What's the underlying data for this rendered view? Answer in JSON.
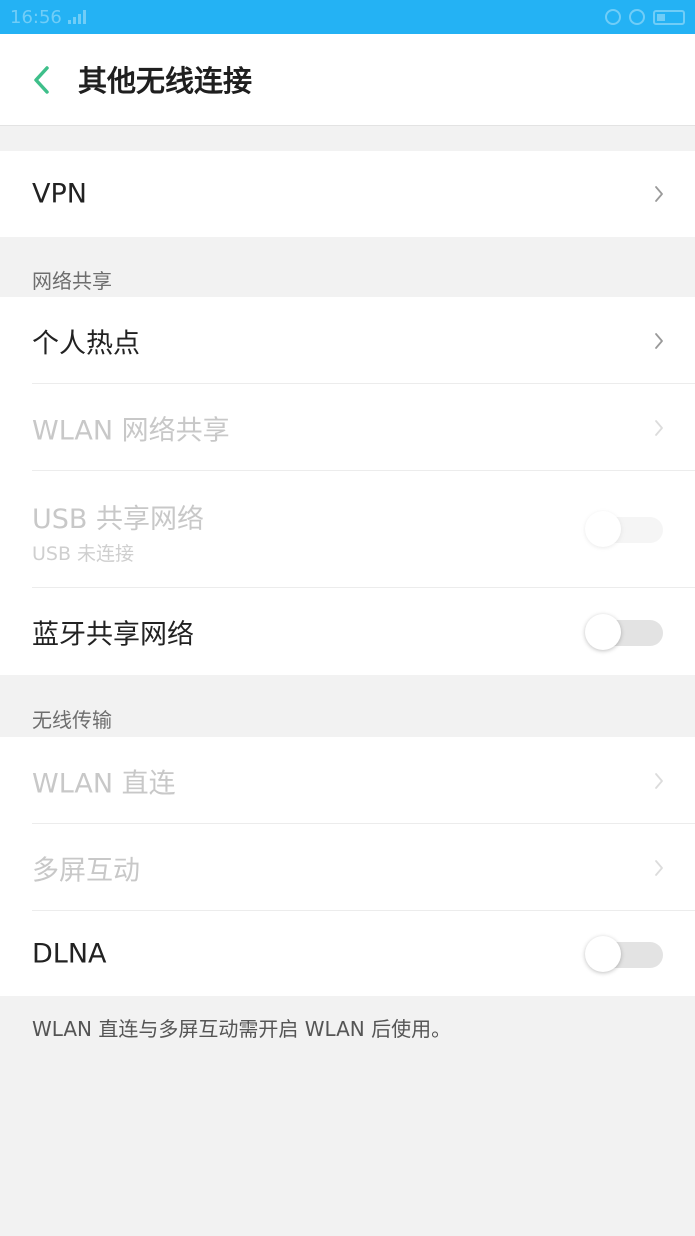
{
  "status_bar": {
    "time": "16:56"
  },
  "header": {
    "title": "其他无线连接"
  },
  "vpn": {
    "label": "VPN"
  },
  "sharing": {
    "section_title": "网络共享",
    "hotspot_label": "个人热点",
    "wlan_share_label": "WLAN 网络共享",
    "usb_share_label": "USB 共享网络",
    "usb_share_status": "USB 未连接",
    "bluetooth_share_label": "蓝牙共享网络"
  },
  "wireless": {
    "section_title": "无线传输",
    "wlan_direct_label": "WLAN 直连",
    "multiscreen_label": "多屏互动",
    "dlna_label": "DLNA"
  },
  "footnote": "WLAN 直连与多屏互动需开启 WLAN 后使用。",
  "colors": {
    "status_bar": "#24b2f4",
    "accent_back": "#3ebf8a",
    "background": "#f2f2f2"
  }
}
